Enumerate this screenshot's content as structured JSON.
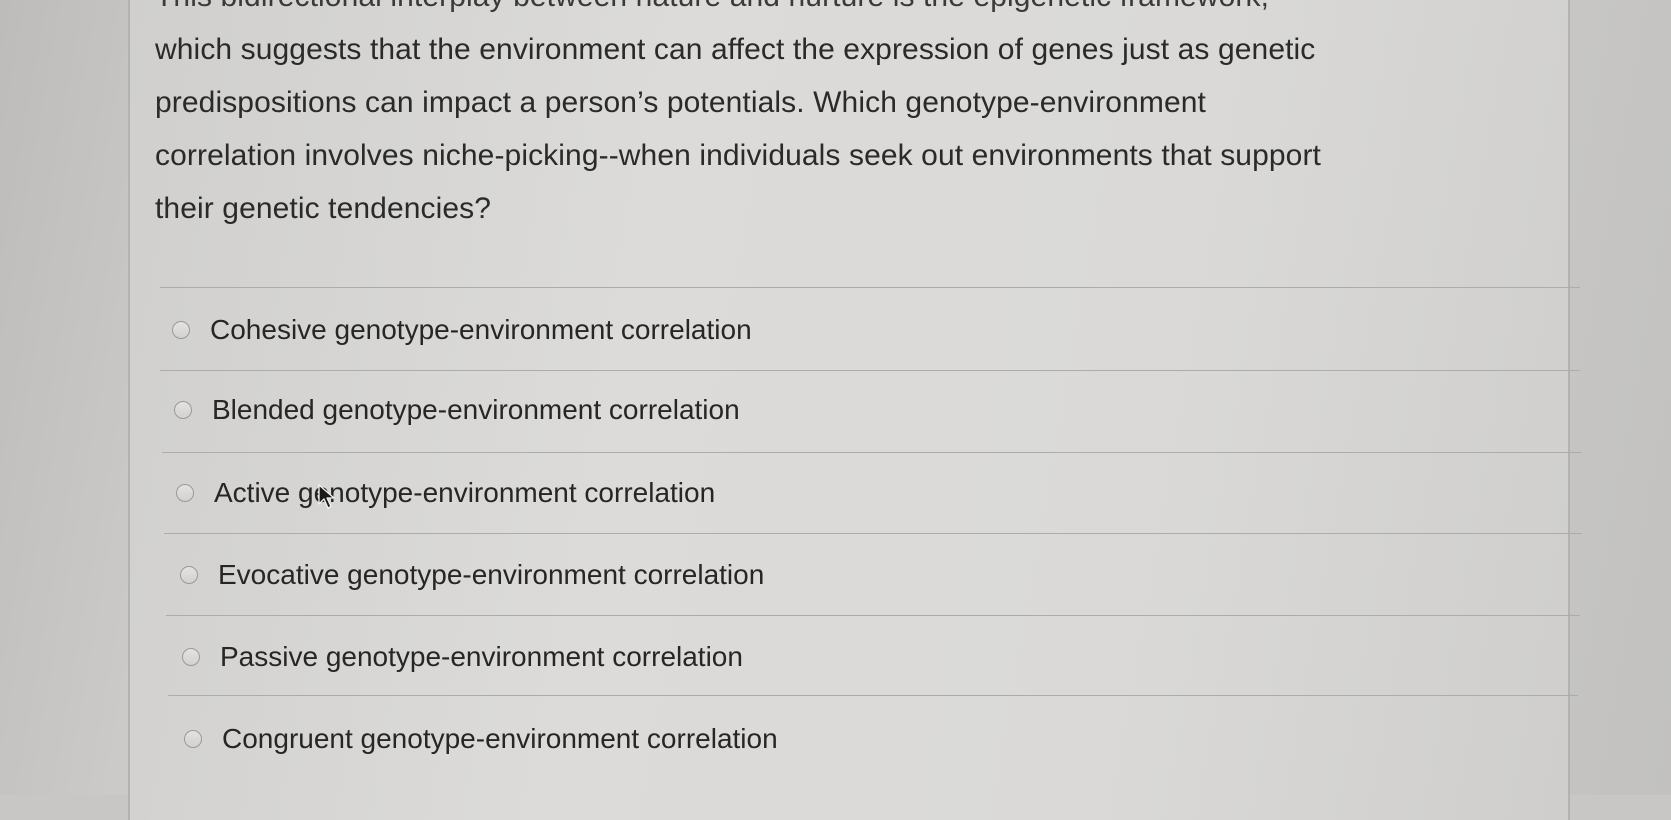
{
  "question": {
    "lines": [
      "This bidirectional interplay between nature and nurture is the epigenetic framework,",
      "which suggests that the environment can affect the expression of genes just as genetic",
      "predispositions can impact a person’s potentials. Which genotype-environment",
      "correlation involves niche-picking--when individuals seek out environments that support",
      "their genetic tendencies?"
    ]
  },
  "options": [
    {
      "label": "Cohesive genotype-environment correlation",
      "selected": false
    },
    {
      "label": "Blended genotype-environment correlation",
      "selected": false
    },
    {
      "label": "Active genotype-environment correlation",
      "selected": false
    },
    {
      "label": "Evocative genotype-environment correlation",
      "selected": false
    },
    {
      "label": "Passive genotype-environment correlation",
      "selected": false
    },
    {
      "label": "Congruent genotype-environment correlation",
      "selected": false
    }
  ],
  "cursor": {
    "icon": "mouse-pointer-icon"
  }
}
